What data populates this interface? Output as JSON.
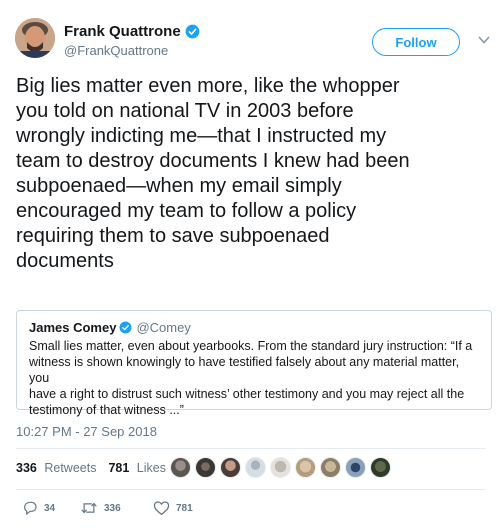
{
  "author": {
    "display_name": "Frank Quattrone",
    "handle": "@FrankQuattrone",
    "verified_icon": "verified-badge-icon"
  },
  "follow_label": "Follow",
  "tweet_text": "Big lies matter even more, like the whopper\nyou told on national TV in 2003 before\nwrongly indicting me—that I instructed my\nteam to destroy documents I knew had been\nsubpoenaed—when my email simply\nencouraged my team to follow a policy\nrequiring them to save subpoenaed\ndocuments",
  "quoted_tweet": {
    "display_name": "James Comey",
    "handle": "@Comey",
    "text": "Small lies matter, even about yearbooks. From the standard jury instruction: “If a\nwitness is shown knowingly to have testified falsely about any material matter, you\nhave a right to distrust such witness’ other testimony and you may reject all the\ntestimony of that witness ...”"
  },
  "timestamp": "10:27 PM - 27 Sep 2018",
  "stats": {
    "retweets_count": "336",
    "retweets_label": "Retweets",
    "likes_count": "781",
    "likes_label": "Likes"
  },
  "liker_avatars": 9,
  "actions": {
    "reply_count": "34",
    "retweet_count": "336",
    "like_count": "781"
  },
  "colors": {
    "accent": "#1da1f2",
    "secondary_text": "#657786",
    "border": "#ccd6dd"
  }
}
